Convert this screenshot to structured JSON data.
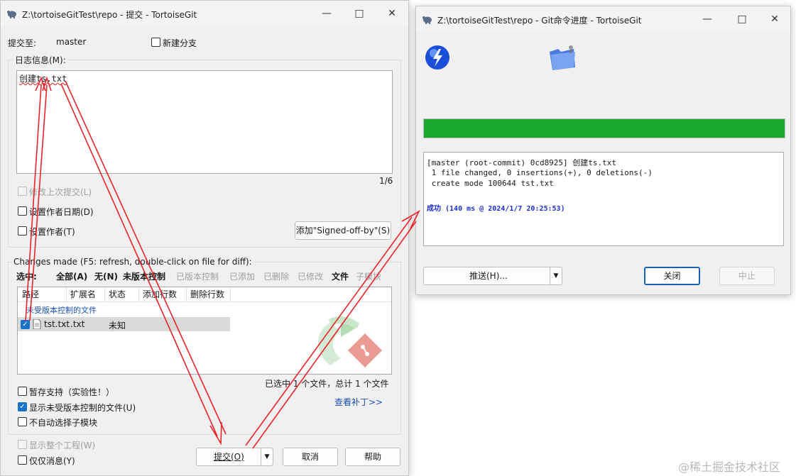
{
  "colors": {
    "accent": "#1a73c8",
    "progress": "#19a82e",
    "link": "#1a4fb0",
    "success": "#1a2fd0",
    "annotation": "#e8242b"
  },
  "commit_window": {
    "title": "Z:\\tortoiseGitTest\\repo - 提交 - TortoiseGit",
    "commit_to_label": "提交至:",
    "branch": "master",
    "new_branch_label": "新建分支",
    "log_message_label": "日志信息(M):",
    "log_message": "创建ts.txt",
    "line_counter": "1/6",
    "amend_label": "修改上次提交(L)",
    "set_author_date_label": "设置作者日期(D)",
    "set_author_label": "设置作者(T)",
    "signed_off_button": "添加\"Signed-off-by\"(S)",
    "changes_label": "Changes made (F5: refresh, double-click on file for diff):",
    "select_label": "选中:",
    "select_options": {
      "all": "全部(A)",
      "none": "无(N)",
      "unversioned": "未版本控制",
      "versioned": "已版本控制",
      "added": "已添加",
      "deleted": "已删除",
      "modified": "已修改",
      "files": "文件",
      "submodules": "子模块"
    },
    "columns": {
      "path": "路径",
      "ext": "扩展名",
      "status": "状态",
      "added_lines": "添加行数",
      "deleted_lines": "删除行数"
    },
    "group_header": "未受版本控制的文件",
    "file_row": {
      "name": "tst.txt",
      "ext": ".txt",
      "status": "未知"
    },
    "selection_summary": "已选中 1 个文件，总计 1 个文件",
    "view_patch_link": "查看补丁>>",
    "stash_support_label": "暂存支持（实验性！）",
    "show_unversioned_label": "显示未受版本控制的文件(U)",
    "no_autoselect_submodules_label": "不自动选择子模块",
    "show_whole_project_label": "显示整个工程(W)",
    "message_only_label": "仅仅消息(Y)",
    "commit_button": "提交(O)",
    "cancel_button": "取消",
    "help_button": "帮助"
  },
  "progress_window": {
    "title": "Z:\\tortoiseGitTest\\repo - Git命令进度 - TortoiseGit",
    "progress": 1.0,
    "output_lines": [
      "[master (root-commit) 0cd8925] 创建ts.txt",
      " 1 file changed, 0 insertions(+), 0 deletions(-)",
      " create mode 100644 tst.txt"
    ],
    "success_line": "成功 (140 ms @ 2024/1/7 20:25:53)",
    "push_button": "推送(H)...",
    "close_button": "关闭",
    "abort_button": "中止"
  },
  "watermark": "@稀土掘金技术社区",
  "icons": {
    "minimize": "minimize-icon",
    "maximize": "maximize-icon",
    "close": "close-icon",
    "app": "tortoisegit-icon"
  }
}
